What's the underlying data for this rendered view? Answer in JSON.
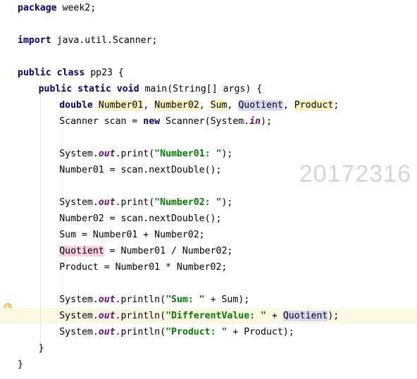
{
  "editor": {
    "language": "java",
    "background_color": "#ffffff",
    "watermark": "20172316",
    "current_line_highlight_color": "#fdf8e3",
    "gutter_icon": "lightbulb-icon",
    "colors": {
      "keyword": "#000080",
      "string": "#008000",
      "static_field": "#660e7a",
      "text": "#000000",
      "read_occurrence_highlight": "#fdf1bd",
      "selection_highlight": "#d6d9f3",
      "write_occurrence_highlight": "#f6cfe0",
      "watermark": "#d4d4d4",
      "indent_guide": "#e4e4e4"
    }
  },
  "code": {
    "lines": [
      {
        "id": 1,
        "indent": 0,
        "tokens": [
          {
            "t": "package",
            "c": "kw"
          },
          {
            "t": " week2;",
            "c": "plain"
          }
        ]
      },
      {
        "id": 2,
        "indent": 0,
        "tokens": []
      },
      {
        "id": 3,
        "indent": 0,
        "tokens": [
          {
            "t": "import",
            "c": "kw"
          },
          {
            "t": " java.util.Scanner;",
            "c": "plain"
          }
        ]
      },
      {
        "id": 4,
        "indent": 0,
        "tokens": []
      },
      {
        "id": 5,
        "indent": 0,
        "tokens": [
          {
            "t": "public class",
            "c": "kw"
          },
          {
            "t": " pp23 {",
            "c": "plain"
          }
        ]
      },
      {
        "id": 6,
        "indent": 1,
        "tokens": [
          {
            "t": "public static void",
            "c": "kw"
          },
          {
            "t": " main(String[] args) {",
            "c": "plain"
          }
        ]
      },
      {
        "id": 7,
        "indent": 2,
        "tokens": [
          {
            "t": "double",
            "c": "kw"
          },
          {
            "t": " ",
            "c": "plain"
          },
          {
            "t": "Number01",
            "c": "plain hl-read"
          },
          {
            "t": ", ",
            "c": "plain"
          },
          {
            "t": "Number02",
            "c": "plain hl-read"
          },
          {
            "t": ", ",
            "c": "plain"
          },
          {
            "t": "Sum",
            "c": "plain hl-read"
          },
          {
            "t": ", ",
            "c": "plain"
          },
          {
            "t": "Quotient",
            "c": "plain hl-sel"
          },
          {
            "t": ", ",
            "c": "plain"
          },
          {
            "t": "Product",
            "c": "plain hl-read"
          },
          {
            "t": ";",
            "c": "plain"
          }
        ]
      },
      {
        "id": 8,
        "indent": 2,
        "tokens": [
          {
            "t": "Scanner scan = ",
            "c": "plain"
          },
          {
            "t": "new",
            "c": "kw"
          },
          {
            "t": " Scanner(System.",
            "c": "plain"
          },
          {
            "t": "in",
            "c": "field"
          },
          {
            "t": ");",
            "c": "plain"
          }
        ]
      },
      {
        "id": 9,
        "indent": 0,
        "tokens": []
      },
      {
        "id": 10,
        "indent": 2,
        "tokens": [
          {
            "t": "System.",
            "c": "plain"
          },
          {
            "t": "out",
            "c": "field"
          },
          {
            "t": ".print(",
            "c": "plain"
          },
          {
            "t": "\"Number01: \"",
            "c": "str"
          },
          {
            "t": ");",
            "c": "plain"
          }
        ]
      },
      {
        "id": 11,
        "indent": 2,
        "tokens": [
          {
            "t": "Number01 = scan.nextDouble();",
            "c": "plain"
          }
        ]
      },
      {
        "id": 12,
        "indent": 0,
        "tokens": []
      },
      {
        "id": 13,
        "indent": 2,
        "tokens": [
          {
            "t": "System.",
            "c": "plain"
          },
          {
            "t": "out",
            "c": "field"
          },
          {
            "t": ".print(",
            "c": "plain"
          },
          {
            "t": "\"Number02: \"",
            "c": "str"
          },
          {
            "t": ");",
            "c": "plain"
          }
        ]
      },
      {
        "id": 14,
        "indent": 2,
        "tokens": [
          {
            "t": "Number02 = scan.nextDouble();",
            "c": "plain"
          }
        ]
      },
      {
        "id": 15,
        "indent": 2,
        "tokens": [
          {
            "t": "Sum = Number01 + Number02;",
            "c": "plain"
          }
        ]
      },
      {
        "id": 16,
        "indent": 2,
        "tokens": [
          {
            "t": "Quotient",
            "c": "plain hl-write"
          },
          {
            "t": " = Number01 / Number02;",
            "c": "plain"
          }
        ]
      },
      {
        "id": 17,
        "indent": 2,
        "tokens": [
          {
            "t": "Product = Number01 * Number02;",
            "c": "plain"
          }
        ]
      },
      {
        "id": 18,
        "indent": 0,
        "tokens": []
      },
      {
        "id": 19,
        "indent": 2,
        "tokens": [
          {
            "t": "System.",
            "c": "plain"
          },
          {
            "t": "out",
            "c": "field"
          },
          {
            "t": ".println(",
            "c": "plain"
          },
          {
            "t": "\"Sum: \"",
            "c": "str"
          },
          {
            "t": " + Sum);",
            "c": "plain"
          }
        ]
      },
      {
        "id": 20,
        "indent": 2,
        "current": true,
        "tokens": [
          {
            "t": "System.",
            "c": "plain"
          },
          {
            "t": "out",
            "c": "field"
          },
          {
            "t": ".println(",
            "c": "plain"
          },
          {
            "t": "\"DifferentValue: \"",
            "c": "str"
          },
          {
            "t": " + ",
            "c": "plain"
          },
          {
            "t": "Quotient",
            "c": "plain hl-sel"
          },
          {
            "t": ");",
            "c": "plain"
          }
        ]
      },
      {
        "id": 21,
        "indent": 2,
        "tokens": [
          {
            "t": "System.",
            "c": "plain"
          },
          {
            "t": "out",
            "c": "field"
          },
          {
            "t": ".println(",
            "c": "plain"
          },
          {
            "t": "\"Product: \"",
            "c": "str"
          },
          {
            "t": " + Product);",
            "c": "plain"
          }
        ]
      },
      {
        "id": 22,
        "indent": 1,
        "tokens": [
          {
            "t": "}",
            "c": "plain"
          }
        ]
      },
      {
        "id": 23,
        "indent": 0,
        "tokens": [
          {
            "t": "}",
            "c": "plain"
          }
        ]
      }
    ]
  }
}
